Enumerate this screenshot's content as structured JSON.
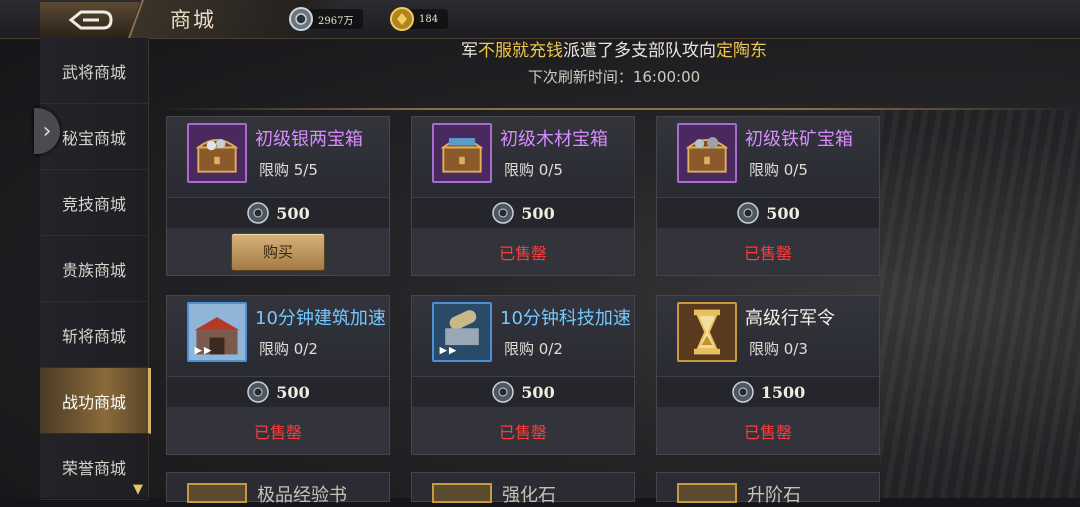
{
  "header": {
    "title": "商城",
    "resources": [
      {
        "icon": "silver-coin-icon",
        "value": "2967万"
      },
      {
        "icon": "gold-coin-icon",
        "value": "184"
      }
    ]
  },
  "sidebar": {
    "items": [
      {
        "label": "武将商城",
        "active": false
      },
      {
        "label": "秘宝商城",
        "active": false
      },
      {
        "label": "竞技商城",
        "active": false
      },
      {
        "label": "贵族商城",
        "active": false
      },
      {
        "label": "斩将商城",
        "active": false
      },
      {
        "label": "战功商城",
        "active": true
      },
      {
        "label": "荣誉商城",
        "active": false
      }
    ]
  },
  "banner": {
    "parts": [
      "军",
      "不服就充钱",
      "派遣了多支部队攻向",
      "定陶东"
    ],
    "refresh": "下次刷新时间：16:00:00"
  },
  "shop": {
    "items": [
      {
        "name": "初级银两宝箱",
        "limit": "限购 5/5",
        "price": "500",
        "status": "购买",
        "name_color": "#d88bff",
        "icon": "silver-chest-icon"
      },
      {
        "name": "初级木材宝箱",
        "limit": "限购 0/5",
        "price": "500",
        "status": "已售罄",
        "name_color": "#d88bff",
        "icon": "wood-chest-icon"
      },
      {
        "name": "初级铁矿宝箱",
        "limit": "限购 0/5",
        "price": "500",
        "status": "已售罄",
        "name_color": "#d88bff",
        "icon": "iron-chest-icon"
      },
      {
        "name": "10分钟建筑加速",
        "limit": "限购 0/2",
        "price": "500",
        "status": "已售罄",
        "name_color": "#74c8ff",
        "icon": "building-speedup-icon"
      },
      {
        "name": "10分钟科技加速",
        "limit": "限购 0/2",
        "price": "500",
        "status": "已售罄",
        "name_color": "#74c8ff",
        "icon": "tech-speedup-icon"
      },
      {
        "name": "高级行军令",
        "limit": "限购 0/3",
        "price": "1500",
        "status": "已售罄",
        "name_color": "#f2eee6",
        "icon": "hourglass-icon"
      }
    ],
    "partial_row": [
      "极品经验书",
      "强化石",
      "升阶石"
    ]
  },
  "colors": {
    "sold_out": "#ff3b3b",
    "accent_gold": "#d8b26a"
  }
}
